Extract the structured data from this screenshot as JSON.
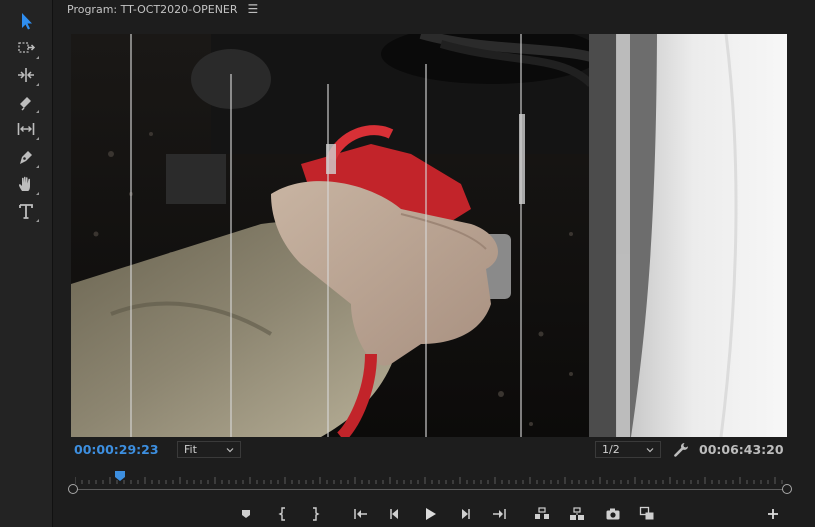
{
  "panel": {
    "title": "Program: TT-OCT2020-OPENER",
    "menu_icon": "hamburger-menu-icon"
  },
  "tools": [
    {
      "name": "selection-tool",
      "icon": "arrow-pointer-icon",
      "active": true
    },
    {
      "name": "track-select-tool",
      "icon": "track-select-icon"
    },
    {
      "name": "ripple-edit-tool",
      "icon": "ripple-edit-icon"
    },
    {
      "name": "razor-tool",
      "icon": "razor-icon"
    },
    {
      "name": "slip-tool",
      "icon": "slip-icon"
    },
    {
      "name": "pen-tool",
      "icon": "pen-icon"
    },
    {
      "name": "hand-tool",
      "icon": "hand-icon"
    },
    {
      "name": "type-tool",
      "icon": "type-icon"
    }
  ],
  "controls": {
    "current_timecode": "00:00:29:23",
    "zoom_value": "Fit",
    "resolution_value": "1/2",
    "duration_timecode": "00:06:43:20"
  },
  "timeline": {
    "playhead_position": 0.063
  },
  "transport": [
    {
      "name": "add-marker-button",
      "icon": "marker-icon"
    },
    {
      "name": "mark-in-button",
      "icon": "mark-in-icon"
    },
    {
      "name": "mark-out-button",
      "icon": "mark-out-icon"
    },
    {
      "name": "go-to-in-button",
      "icon": "go-to-in-icon"
    },
    {
      "name": "step-back-button",
      "icon": "step-back-icon"
    },
    {
      "name": "play-button",
      "icon": "play-icon"
    },
    {
      "name": "step-forward-button",
      "icon": "step-forward-icon"
    },
    {
      "name": "go-to-out-button",
      "icon": "go-to-out-icon"
    },
    {
      "name": "lift-button",
      "icon": "lift-icon"
    },
    {
      "name": "extract-button",
      "icon": "extract-icon"
    },
    {
      "name": "export-frame-button",
      "icon": "camera-icon"
    },
    {
      "name": "compare-view-button",
      "icon": "compare-icon"
    },
    {
      "name": "button-editor-button",
      "icon": "plus-icon"
    }
  ],
  "colors": {
    "accent": "#3d8fe0",
    "panel_bg": "#1d1d1d"
  }
}
